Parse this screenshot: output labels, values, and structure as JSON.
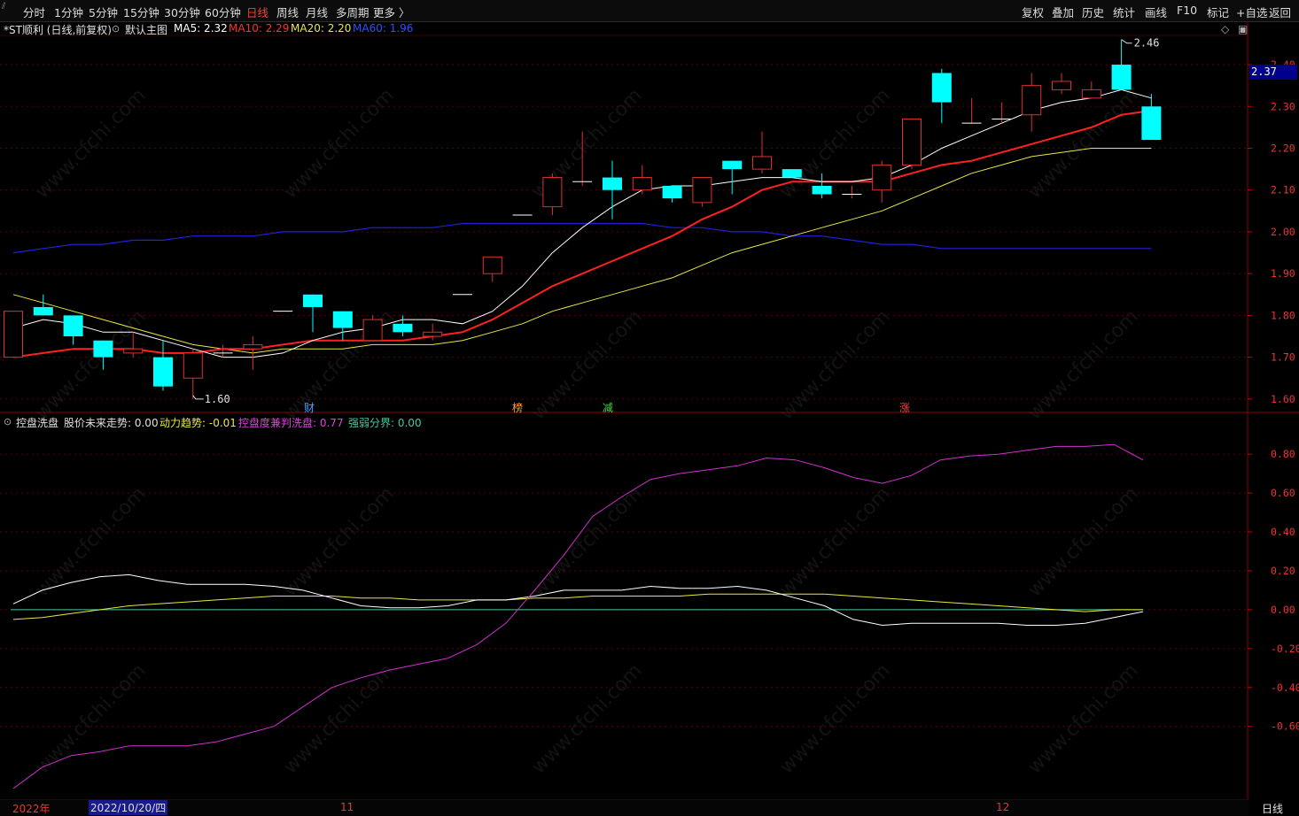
{
  "toolbar": {
    "periods": [
      "分时",
      "1分钟",
      "5分钟",
      "15分钟",
      "30分钟",
      "60分钟",
      "日线",
      "周线",
      "月线",
      "多周期",
      "更多 〉"
    ],
    "active_period": "日线",
    "tools": [
      "复权",
      "叠加",
      "历史",
      "统计",
      "画线",
      "F10",
      "标记",
      "+自选",
      "返回"
    ]
  },
  "main_info": {
    "title": "*ST顺利 (日线,前复权)",
    "template": "默认主图",
    "ma5": "MA5: 2.32",
    "ma10": "MA10: 2.29",
    "ma20": "MA20: 2.20",
    "ma60": "MA60: 1.96"
  },
  "indicator_info": {
    "name": "控盘洗盘",
    "future": "股价未来走势: 0.00",
    "momentum": "动力趋势: -0.01",
    "control": "控盘度兼判洗盘: 0.77",
    "divide": "强弱分界: 0.00"
  },
  "price_axis": [
    "2.40",
    "2.30",
    "2.20",
    "2.10",
    "2.00",
    "1.90",
    "1.80",
    "1.70",
    "1.60"
  ],
  "last_price": "2.37",
  "high_label": "2.46",
  "low_label": "1.60",
  "indicator_axis": [
    "0.80",
    "0.60",
    "0.40",
    "0.20",
    "0.00",
    "-0.20",
    "-0.40",
    "-0.60"
  ],
  "events": [
    {
      "label": "财",
      "color": "#4aa3ff"
    },
    {
      "label": "榜",
      "color": "#ff9a2e"
    },
    {
      "label": "减",
      "color": "#3ddc3d"
    },
    {
      "label": "涨",
      "color": "#ff3b3b"
    }
  ],
  "dates": {
    "year": "2022年",
    "cursor": "2022/10/20/四",
    "nov": "11",
    "dec": "12",
    "period": "日线"
  },
  "watermark": "www.cfchi.com",
  "colors": {
    "up": "#e03030",
    "down": "#00ffff",
    "ma5": "#ffffff",
    "ma10": "#ff2020",
    "ma20": "#e8e840",
    "ma60": "#2020dd",
    "control": "#d030d0"
  },
  "chart_data": {
    "type": "line",
    "candles": [
      {
        "o": 1.7,
        "h": 1.81,
        "l": 1.7,
        "c": 1.81
      },
      {
        "o": 1.82,
        "h": 1.85,
        "l": 1.8,
        "c": 1.8
      },
      {
        "o": 1.8,
        "h": 1.8,
        "l": 1.73,
        "c": 1.75
      },
      {
        "o": 1.74,
        "h": 1.74,
        "l": 1.67,
        "c": 1.7
      },
      {
        "o": 1.71,
        "h": 1.76,
        "l": 1.7,
        "c": 1.72
      },
      {
        "o": 1.7,
        "h": 1.74,
        "l": 1.62,
        "c": 1.63
      },
      {
        "o": 1.65,
        "h": 1.72,
        "l": 1.6,
        "c": 1.71
      },
      {
        "o": 1.71,
        "h": 1.73,
        "l": 1.7,
        "c": 1.71
      },
      {
        "o": 1.72,
        "h": 1.75,
        "l": 1.67,
        "c": 1.73
      },
      {
        "o": 1.81,
        "h": 1.81,
        "l": 1.81,
        "c": 1.81
      },
      {
        "o": 1.85,
        "h": 1.85,
        "l": 1.76,
        "c": 1.82
      },
      {
        "o": 1.81,
        "h": 1.81,
        "l": 1.74,
        "c": 1.77
      },
      {
        "o": 1.74,
        "h": 1.8,
        "l": 1.74,
        "c": 1.79
      },
      {
        "o": 1.78,
        "h": 1.8,
        "l": 1.75,
        "c": 1.76
      },
      {
        "o": 1.75,
        "h": 1.78,
        "l": 1.74,
        "c": 1.76
      },
      {
        "o": 1.85,
        "h": 1.85,
        "l": 1.85,
        "c": 1.85
      },
      {
        "o": 1.9,
        "h": 1.94,
        "l": 1.88,
        "c": 1.94
      },
      {
        "o": 2.04,
        "h": 2.04,
        "l": 2.04,
        "c": 2.04
      },
      {
        "o": 2.06,
        "h": 2.14,
        "l": 2.04,
        "c": 2.13
      },
      {
        "o": 2.12,
        "h": 2.24,
        "l": 2.11,
        "c": 2.12
      },
      {
        "o": 2.13,
        "h": 2.17,
        "l": 2.03,
        "c": 2.1
      },
      {
        "o": 2.1,
        "h": 2.16,
        "l": 2.09,
        "c": 2.13
      },
      {
        "o": 2.11,
        "h": 2.11,
        "l": 2.07,
        "c": 2.08
      },
      {
        "o": 2.07,
        "h": 2.13,
        "l": 2.06,
        "c": 2.13
      },
      {
        "o": 2.17,
        "h": 2.17,
        "l": 2.09,
        "c": 2.15
      },
      {
        "o": 2.15,
        "h": 2.24,
        "l": 2.14,
        "c": 2.18
      },
      {
        "o": 2.15,
        "h": 2.15,
        "l": 2.13,
        "c": 2.13
      },
      {
        "o": 2.11,
        "h": 2.14,
        "l": 2.08,
        "c": 2.09
      },
      {
        "o": 2.09,
        "h": 2.11,
        "l": 2.08,
        "c": 2.09
      },
      {
        "o": 2.1,
        "h": 2.17,
        "l": 2.07,
        "c": 2.16
      },
      {
        "o": 2.16,
        "h": 2.27,
        "l": 2.15,
        "c": 2.27
      },
      {
        "o": 2.38,
        "h": 2.39,
        "l": 2.26,
        "c": 2.31
      },
      {
        "o": 2.26,
        "h": 2.32,
        "l": 2.26,
        "c": 2.26
      },
      {
        "o": 2.27,
        "h": 2.31,
        "l": 2.26,
        "c": 2.27
      },
      {
        "o": 2.28,
        "h": 2.38,
        "l": 2.24,
        "c": 2.35
      },
      {
        "o": 2.34,
        "h": 2.38,
        "l": 2.33,
        "c": 2.36
      },
      {
        "o": 2.32,
        "h": 2.36,
        "l": 2.32,
        "c": 2.34
      },
      {
        "o": 2.4,
        "h": 2.46,
        "l": 2.34,
        "c": 2.34
      },
      {
        "o": 2.3,
        "h": 2.33,
        "l": 2.22,
        "c": 2.22
      }
    ],
    "ma5": [
      1.77,
      1.79,
      1.78,
      1.76,
      1.76,
      1.74,
      1.72,
      1.7,
      1.7,
      1.71,
      1.74,
      1.76,
      1.77,
      1.79,
      1.79,
      1.78,
      1.81,
      1.87,
      1.95,
      2.01,
      2.06,
      2.1,
      2.11,
      2.11,
      2.12,
      2.13,
      2.13,
      2.12,
      2.12,
      2.13,
      2.16,
      2.2,
      2.23,
      2.26,
      2.29,
      2.31,
      2.32,
      2.34,
      2.32
    ],
    "ma10": [
      1.7,
      1.71,
      1.72,
      1.72,
      1.72,
      1.71,
      1.71,
      1.72,
      1.72,
      1.73,
      1.74,
      1.74,
      1.74,
      1.74,
      1.75,
      1.76,
      1.79,
      1.83,
      1.87,
      1.9,
      1.93,
      1.96,
      1.99,
      2.03,
      2.06,
      2.1,
      2.12,
      2.12,
      2.12,
      2.12,
      2.14,
      2.16,
      2.17,
      2.19,
      2.21,
      2.23,
      2.25,
      2.28,
      2.29
    ],
    "ma20": [
      1.85,
      1.83,
      1.81,
      1.79,
      1.77,
      1.75,
      1.73,
      1.72,
      1.71,
      1.72,
      1.72,
      1.72,
      1.73,
      1.73,
      1.73,
      1.74,
      1.76,
      1.78,
      1.81,
      1.83,
      1.85,
      1.87,
      1.89,
      1.92,
      1.95,
      1.97,
      1.99,
      2.01,
      2.03,
      2.05,
      2.08,
      2.11,
      2.14,
      2.16,
      2.18,
      2.19,
      2.2,
      2.2,
      2.2
    ],
    "ma60": [
      1.95,
      1.96,
      1.97,
      1.97,
      1.98,
      1.98,
      1.99,
      1.99,
      1.99,
      2.0,
      2.0,
      2.0,
      2.01,
      2.01,
      2.01,
      2.02,
      2.02,
      2.02,
      2.02,
      2.02,
      2.02,
      2.02,
      2.01,
      2.01,
      2.0,
      2.0,
      1.99,
      1.99,
      1.98,
      1.97,
      1.97,
      1.96,
      1.96,
      1.96,
      1.96,
      1.96,
      1.96,
      1.96,
      1.96
    ],
    "indicator": {
      "control": [
        -0.92,
        -0.81,
        -0.75,
        -0.73,
        -0.7,
        -0.7,
        -0.7,
        -0.68,
        -0.64,
        -0.6,
        -0.5,
        -0.4,
        -0.35,
        -0.31,
        -0.28,
        -0.25,
        -0.18,
        -0.07,
        0.1,
        0.28,
        0.48,
        0.58,
        0.67,
        0.7,
        0.72,
        0.74,
        0.78,
        0.77,
        0.73,
        0.68,
        0.65,
        0.69,
        0.77,
        0.79,
        0.8,
        0.82,
        0.84,
        0.84,
        0.85,
        0.77
      ],
      "momentum": [
        0.03,
        0.1,
        0.14,
        0.17,
        0.18,
        0.15,
        0.13,
        0.13,
        0.13,
        0.12,
        0.1,
        0.06,
        0.02,
        0.01,
        0.01,
        0.02,
        0.05,
        0.05,
        0.07,
        0.1,
        0.1,
        0.1,
        0.12,
        0.11,
        0.11,
        0.12,
        0.1,
        0.06,
        0.02,
        -0.05,
        -0.08,
        -0.07,
        -0.07,
        -0.07,
        -0.07,
        -0.08,
        -0.08,
        -0.07,
        -0.04,
        -0.01
      ],
      "trend": [
        -0.05,
        -0.04,
        -0.02,
        0.0,
        0.02,
        0.03,
        0.04,
        0.05,
        0.06,
        0.07,
        0.07,
        0.07,
        0.06,
        0.06,
        0.05,
        0.05,
        0.05,
        0.05,
        0.06,
        0.06,
        0.07,
        0.07,
        0.07,
        0.07,
        0.08,
        0.08,
        0.08,
        0.08,
        0.08,
        0.07,
        0.06,
        0.05,
        0.04,
        0.03,
        0.02,
        0.01,
        0.0,
        -0.01,
        0.0,
        0.0
      ],
      "divide": 0.0
    },
    "price_ylim": [
      1.57,
      2.47
    ],
    "indicator_ylim": [
      -0.97,
      0.96
    ]
  }
}
